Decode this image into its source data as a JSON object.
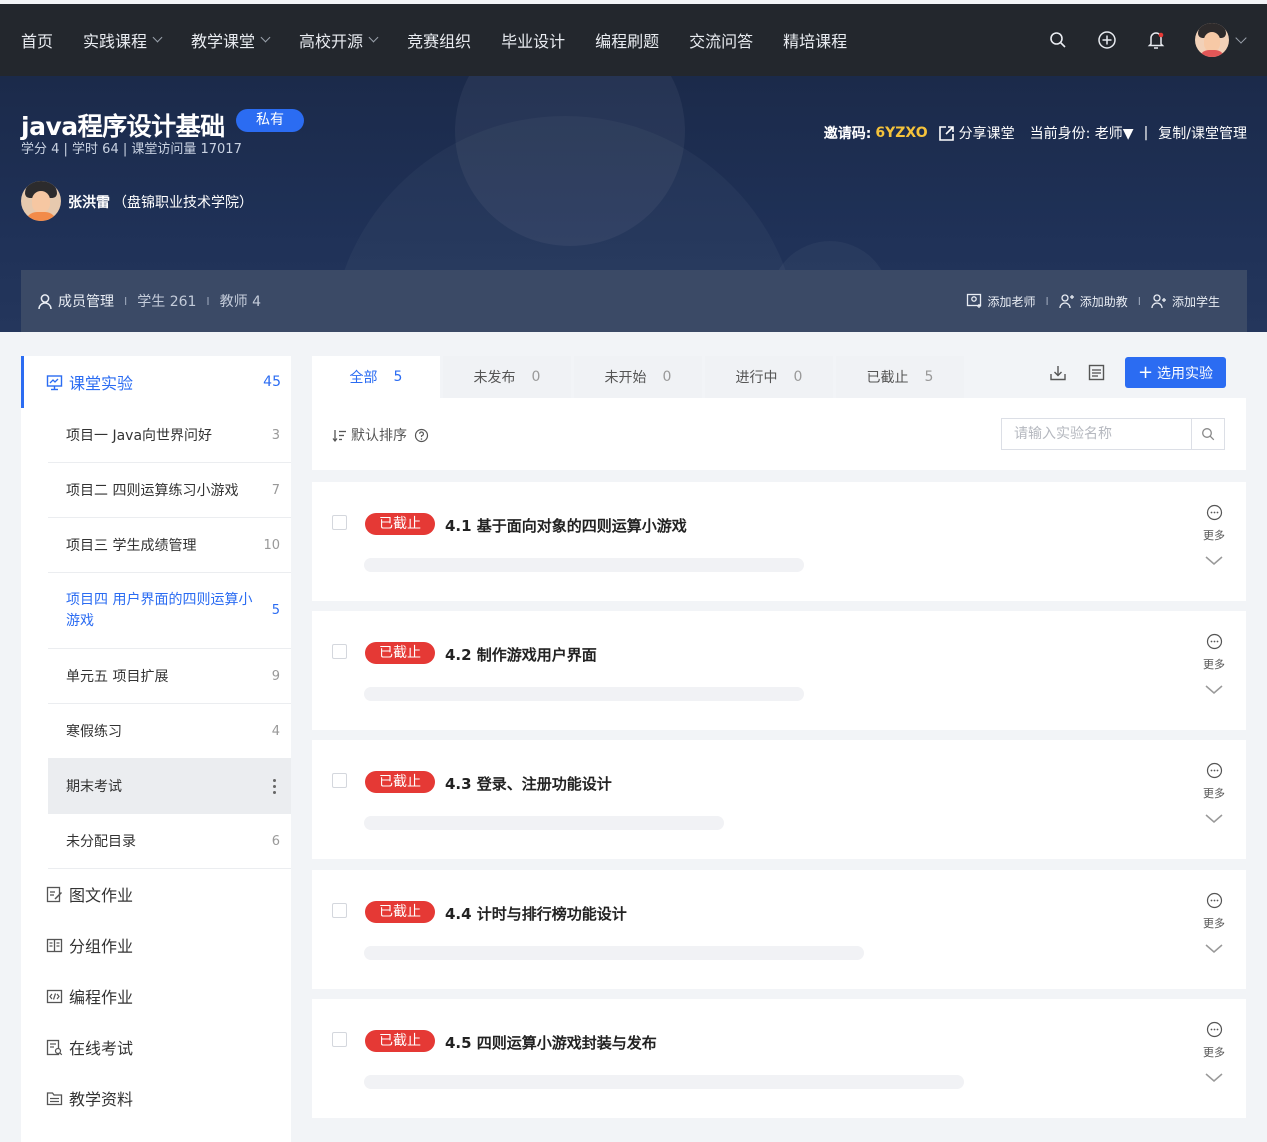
{
  "nav": {
    "items": [
      {
        "label": "首页",
        "dropdown": false
      },
      {
        "label": "实践课程",
        "dropdown": true
      },
      {
        "label": "教学课堂",
        "dropdown": true
      },
      {
        "label": "高校开源",
        "dropdown": true
      },
      {
        "label": "竞赛组织",
        "dropdown": false
      },
      {
        "label": "毕业设计",
        "dropdown": false
      },
      {
        "label": "编程刷题",
        "dropdown": false
      },
      {
        "label": "交流问答",
        "dropdown": false
      },
      {
        "label": "精培课程",
        "dropdown": false
      }
    ],
    "icons": [
      "search-icon",
      "plus-circle-icon",
      "bell-icon",
      "avatar"
    ]
  },
  "course": {
    "title": "java程序设计基础",
    "badge": "私有",
    "meta": "学分 4 | 学时 64 | 课堂访问量 17017",
    "teacher_name": "张洪雷",
    "teacher_school": "（盘锦职业技术学院）",
    "invite_label": "邀请码:",
    "invite_code": "6YZXO",
    "share": "分享课堂",
    "role": "当前身份: 老师▼",
    "divider": "|",
    "copy_manage": "复制/课堂管理"
  },
  "members": {
    "title": "成员管理",
    "students": "学生 261",
    "teachers": "教师 4",
    "sep": "I",
    "add_teacher": "添加老师",
    "add_assistant": "添加助教",
    "add_student": "添加学生"
  },
  "sidebar": {
    "head": {
      "label": "课堂实验",
      "count": "45"
    },
    "subs": [
      {
        "label": "项目一 Java向世界问好",
        "count": "3"
      },
      {
        "label": "项目二 四则运算练习小游戏",
        "count": "7"
      },
      {
        "label": "项目三 学生成绩管理",
        "count": "10"
      },
      {
        "label": "项目四 用户界面的四则运算小游戏",
        "count": "5"
      },
      {
        "label": "单元五 项目扩展",
        "count": "9"
      },
      {
        "label": "寒假练习",
        "count": "4"
      },
      {
        "label": "期末考试",
        "count": ""
      },
      {
        "label": "未分配目录",
        "count": "6"
      }
    ],
    "mains": [
      {
        "label": "图文作业"
      },
      {
        "label": "分组作业"
      },
      {
        "label": "编程作业"
      },
      {
        "label": "在线考试"
      },
      {
        "label": "教学资料"
      }
    ]
  },
  "tabs": [
    {
      "label": "全部",
      "num": "5"
    },
    {
      "label": "未发布",
      "num": "0"
    },
    {
      "label": "未开始",
      "num": "0"
    },
    {
      "label": "进行中",
      "num": "0"
    },
    {
      "label": "已截止",
      "num": "5"
    }
  ],
  "toolbar": {
    "select_label": "选用实验",
    "sort_label": "默认排序"
  },
  "search": {
    "placeholder": "请输入实验名称",
    "value": ""
  },
  "experiments": [
    {
      "status": "已截止",
      "title": "4.1 基于面向对象的四则运算小游戏",
      "more": "更多"
    },
    {
      "status": "已截止",
      "title": "4.2 制作游戏用户界面",
      "more": "更多"
    },
    {
      "status": "已截止",
      "title": "4.3 登录、注册功能设计",
      "more": "更多"
    },
    {
      "status": "已截止",
      "title": "4.4 计时与排行榜功能设计",
      "more": "更多"
    },
    {
      "status": "已截止",
      "title": "4.5 四则运算小游戏封装与发布",
      "more": "更多"
    }
  ],
  "colors": {
    "accent": "#2b6cf2",
    "danger": "#e53935",
    "nav_bg": "#23272d",
    "invite_code": "#f5c33b"
  }
}
